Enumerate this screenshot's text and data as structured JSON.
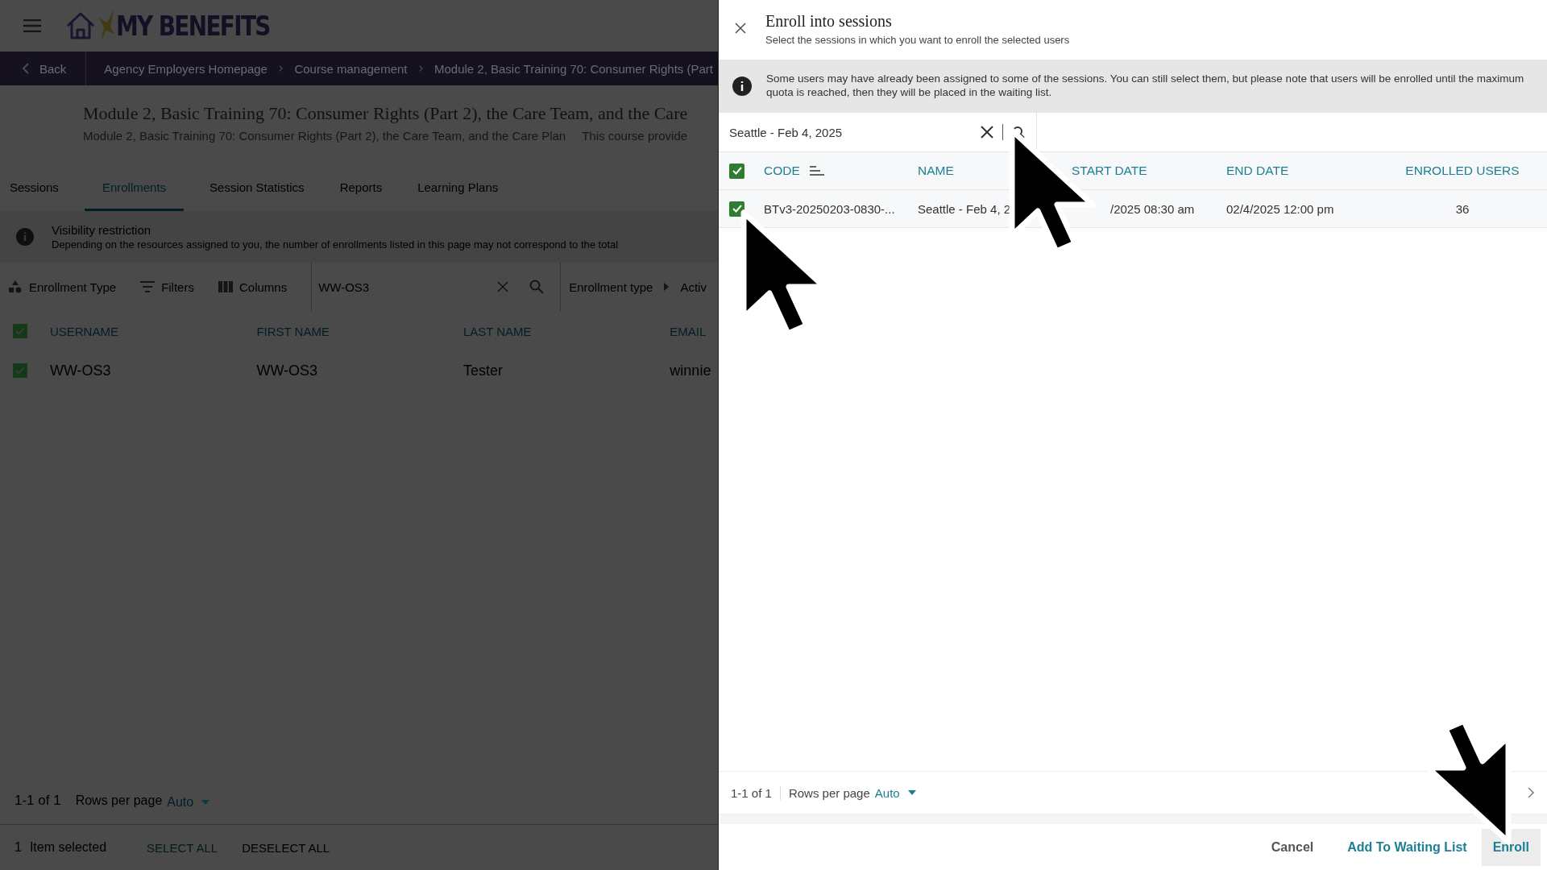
{
  "header": {
    "logo": "MY BENEFITS"
  },
  "breadcrumb": {
    "back": "Back",
    "items": [
      "Agency Employers Homepage",
      "Course management",
      "Module 2, Basic Training 70: Consumer Rights (Part"
    ]
  },
  "course": {
    "title": "Module 2, Basic Training 70: Consumer Rights (Part 2), the Care Team, and the Care",
    "subtitle": "Module 2, Basic Training 70: Consumer Rights (Part 2), the Care Team, and the Care Plan",
    "description": "This course provide"
  },
  "tabs": [
    {
      "label": "Sessions",
      "selected": false
    },
    {
      "label": "Enrollments",
      "selected": true
    },
    {
      "label": "Session Statistics",
      "selected": false
    },
    {
      "label": "Reports",
      "selected": false
    },
    {
      "label": "Learning Plans",
      "selected": false
    }
  ],
  "notice": {
    "title": "Visibility restriction",
    "text": "Depending on the resources assigned to you, the number of enrollments listed in this page may not correspond to the total"
  },
  "toolbar": {
    "buttons": [
      {
        "kind": "type",
        "label": "Enrollment Type"
      },
      {
        "kind": "filter",
        "label": "Filters"
      },
      {
        "kind": "columns",
        "label": "Columns"
      }
    ],
    "search": {
      "value": "WW-OS3"
    },
    "chips": [
      "Enrollment type",
      "Activ"
    ]
  },
  "table": {
    "select_all_checked": true,
    "columns": [
      "USERNAME",
      "FIRST NAME",
      "LAST NAME",
      "EMAIL"
    ],
    "rows": [
      {
        "checked": true,
        "cells": [
          "WW-OS3",
          "WW-OS3",
          "Tester",
          "winnie"
        ]
      }
    ]
  },
  "pagination": {
    "range": "1-1 of 1",
    "rows_label": "Rows per page",
    "rows_value": "Auto"
  },
  "selection_bar": {
    "count": "1",
    "label": "Item selected",
    "actions": [
      "SELECT ALL",
      "DESELECT ALL"
    ]
  },
  "dialog": {
    "title": "Enroll into sessions",
    "subtitle": "Select the sessions in which you want to enroll the selected users",
    "info": "Some users may have already been assigned to some of the sessions. You can still select them, but please note that users will be enrolled until the maximum quota is reached, then they will be placed in the waiting list.",
    "search": {
      "value": "Seattle - Feb 4, 2025"
    },
    "table": {
      "select_all_checked": true,
      "columns": [
        "CODE",
        "NAME",
        "START DATE",
        "END DATE",
        "ENROLLED USERS"
      ],
      "rows": [
        {
          "checked": true,
          "cells": [
            "BTv3-20250203-0830-...",
            "Seattle - Feb 4, 2",
            "/2025 08:30 am",
            "02/4/2025 12:00 pm",
            "36"
          ]
        }
      ]
    },
    "pagination": {
      "range": "1-1 of 1",
      "rows_label": "Rows per page",
      "rows_value": "Auto"
    },
    "buttons": [
      {
        "kind": "cancel",
        "label": "Cancel"
      },
      {
        "kind": "secondary",
        "label": "Add To Waiting List"
      },
      {
        "kind": "primary",
        "label": "Enroll"
      }
    ]
  }
}
